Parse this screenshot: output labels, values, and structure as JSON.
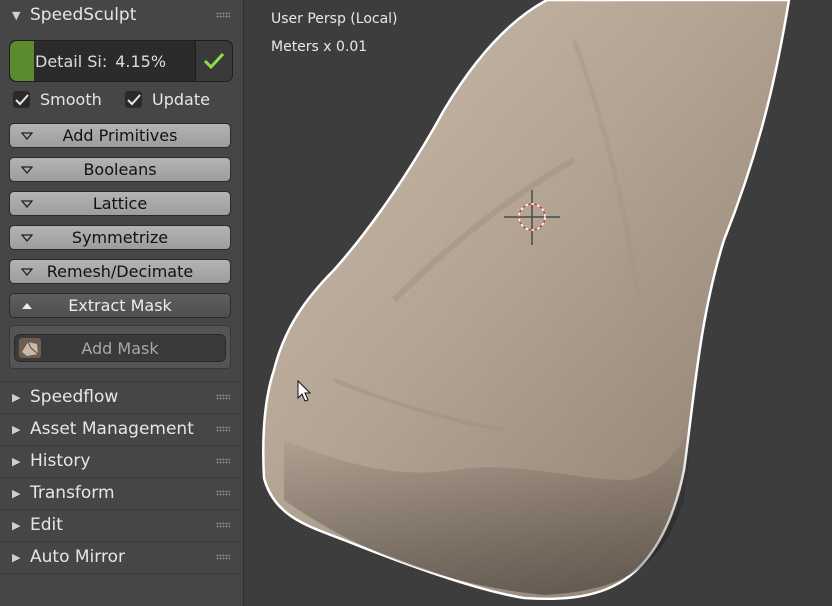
{
  "panel": {
    "title": "SpeedSculpt",
    "detail": {
      "label": "Detail Si:",
      "value": "4.15%"
    },
    "checkboxes": [
      {
        "label": "Smooth",
        "checked": true
      },
      {
        "label": "Update",
        "checked": true
      }
    ],
    "buttons": [
      "Add Primitives",
      "Booleans",
      "Lattice",
      "Symmetrize",
      "Remesh/Decimate"
    ],
    "extract": "Extract Mask",
    "add_mask": "Add Mask",
    "sections": [
      "Speedflow",
      "Asset Management",
      "History",
      "Transform",
      "Edit",
      "Auto Mirror"
    ]
  },
  "viewport": {
    "view_label": "User Persp (Local)",
    "units_label": "Meters x 0.01"
  },
  "colors": {
    "accent": "#5a8c2e",
    "check": "#8be04a"
  }
}
